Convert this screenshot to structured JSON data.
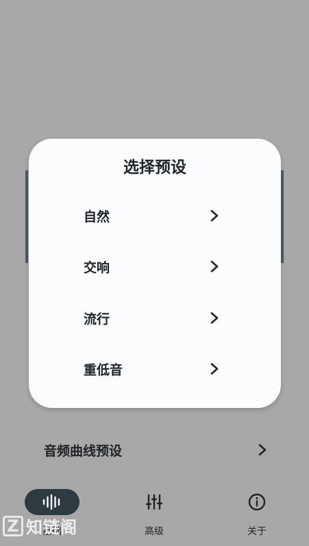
{
  "dialog": {
    "title": "选择预设",
    "options": [
      {
        "label": "自然"
      },
      {
        "label": "交响"
      },
      {
        "label": "流行"
      },
      {
        "label": "重低音"
      }
    ]
  },
  "curve_preset_row": {
    "label": "音频曲线预设"
  },
  "nav": {
    "items": [
      {
        "label": "基础",
        "icon": "waveform-icon",
        "active": true
      },
      {
        "label": "高级",
        "icon": "sliders-icon",
        "active": false
      },
      {
        "label": "关于",
        "icon": "info-icon",
        "active": false
      }
    ]
  },
  "watermark": {
    "letter": "Z",
    "text": "知链阁"
  },
  "colors": {
    "backdrop": "#a9a8a9",
    "dialog": "#fbfcfd",
    "text": "#1d2327",
    "active_nav": "#2d3a40"
  }
}
